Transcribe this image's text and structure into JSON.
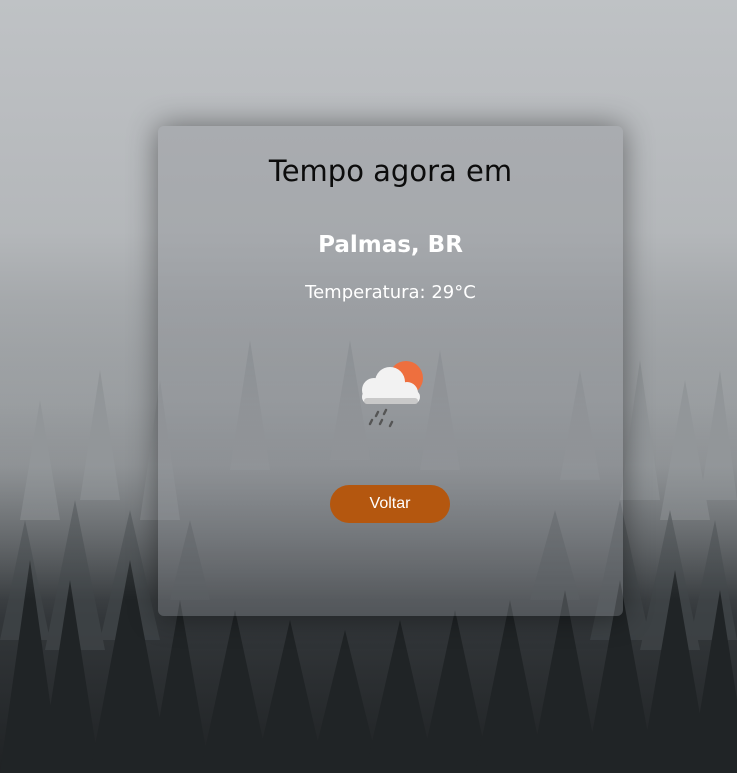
{
  "card": {
    "title": "Tempo agora em",
    "city": "Palmas, BR",
    "temperature_label": "Temperatura:",
    "temperature_value": "29°C",
    "weather_icon": "cloud-sun-rain-icon",
    "back_label": "Voltar"
  },
  "colors": {
    "button": "#b4570f",
    "sun": "#ee6f3e",
    "cloud": "#f2f2f2"
  }
}
